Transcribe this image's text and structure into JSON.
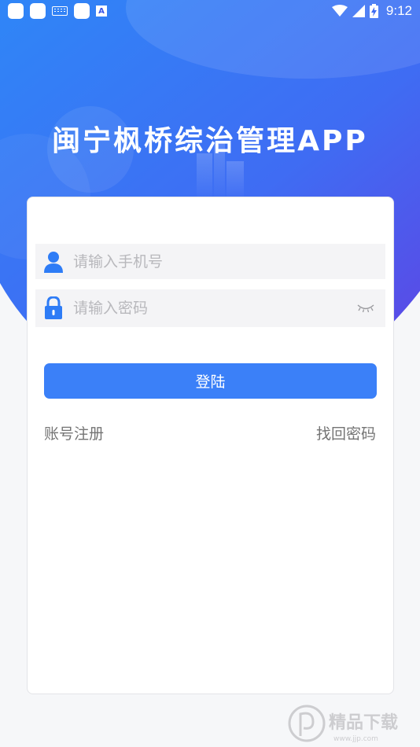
{
  "status_bar": {
    "time": "9:12",
    "icons": [
      "notification-square-icon",
      "notification-square-icon",
      "keyboard-icon",
      "notification-square-icon",
      "a-badge-icon",
      "wifi-icon",
      "signal-icon",
      "battery-charging-icon"
    ],
    "a_badge": "A"
  },
  "app": {
    "title": "闽宁枫桥综治管理APP",
    "theme_colors": {
      "primary": "#3b80f8",
      "hero_start": "#2f7bf5",
      "hero_end": "#5548e8"
    }
  },
  "login": {
    "phone_placeholder": "请输入手机号",
    "password_placeholder": "请输入密码",
    "login_button": "登陆",
    "register_link": "账号注册",
    "forgot_link": "找回密码"
  },
  "watermark": {
    "text": "精品下载",
    "url": "www.jjp.com"
  }
}
